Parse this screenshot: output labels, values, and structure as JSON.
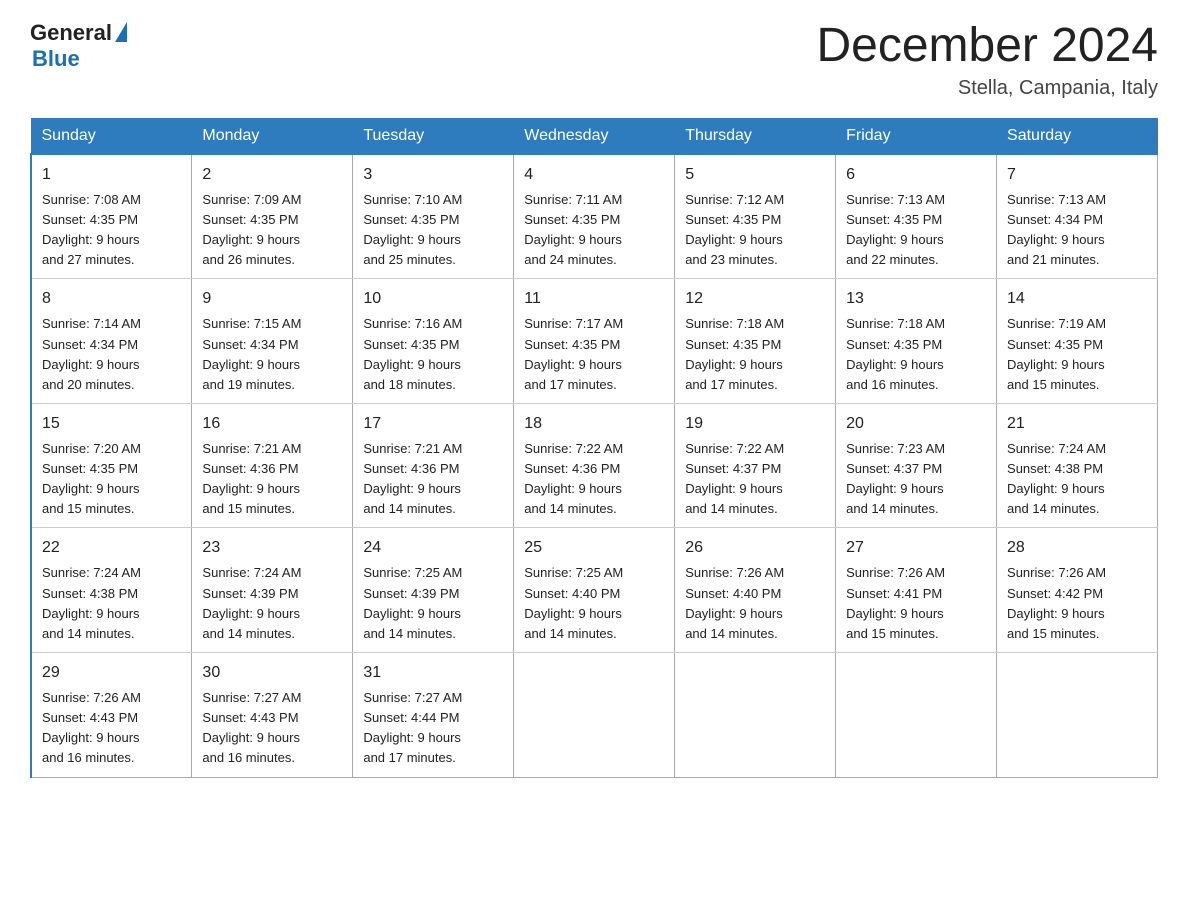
{
  "header": {
    "logo_general": "General",
    "logo_blue": "Blue",
    "month_title": "December 2024",
    "location": "Stella, Campania, Italy"
  },
  "days_of_week": [
    "Sunday",
    "Monday",
    "Tuesday",
    "Wednesday",
    "Thursday",
    "Friday",
    "Saturday"
  ],
  "weeks": [
    [
      {
        "day": "1",
        "sunrise": "7:08 AM",
        "sunset": "4:35 PM",
        "daylight": "9 hours and 27 minutes."
      },
      {
        "day": "2",
        "sunrise": "7:09 AM",
        "sunset": "4:35 PM",
        "daylight": "9 hours and 26 minutes."
      },
      {
        "day": "3",
        "sunrise": "7:10 AM",
        "sunset": "4:35 PM",
        "daylight": "9 hours and 25 minutes."
      },
      {
        "day": "4",
        "sunrise": "7:11 AM",
        "sunset": "4:35 PM",
        "daylight": "9 hours and 24 minutes."
      },
      {
        "day": "5",
        "sunrise": "7:12 AM",
        "sunset": "4:35 PM",
        "daylight": "9 hours and 23 minutes."
      },
      {
        "day": "6",
        "sunrise": "7:13 AM",
        "sunset": "4:35 PM",
        "daylight": "9 hours and 22 minutes."
      },
      {
        "day": "7",
        "sunrise": "7:13 AM",
        "sunset": "4:34 PM",
        "daylight": "9 hours and 21 minutes."
      }
    ],
    [
      {
        "day": "8",
        "sunrise": "7:14 AM",
        "sunset": "4:34 PM",
        "daylight": "9 hours and 20 minutes."
      },
      {
        "day": "9",
        "sunrise": "7:15 AM",
        "sunset": "4:34 PM",
        "daylight": "9 hours and 19 minutes."
      },
      {
        "day": "10",
        "sunrise": "7:16 AM",
        "sunset": "4:35 PM",
        "daylight": "9 hours and 18 minutes."
      },
      {
        "day": "11",
        "sunrise": "7:17 AM",
        "sunset": "4:35 PM",
        "daylight": "9 hours and 17 minutes."
      },
      {
        "day": "12",
        "sunrise": "7:18 AM",
        "sunset": "4:35 PM",
        "daylight": "9 hours and 17 minutes."
      },
      {
        "day": "13",
        "sunrise": "7:18 AM",
        "sunset": "4:35 PM",
        "daylight": "9 hours and 16 minutes."
      },
      {
        "day": "14",
        "sunrise": "7:19 AM",
        "sunset": "4:35 PM",
        "daylight": "9 hours and 15 minutes."
      }
    ],
    [
      {
        "day": "15",
        "sunrise": "7:20 AM",
        "sunset": "4:35 PM",
        "daylight": "9 hours and 15 minutes."
      },
      {
        "day": "16",
        "sunrise": "7:21 AM",
        "sunset": "4:36 PM",
        "daylight": "9 hours and 15 minutes."
      },
      {
        "day": "17",
        "sunrise": "7:21 AM",
        "sunset": "4:36 PM",
        "daylight": "9 hours and 14 minutes."
      },
      {
        "day": "18",
        "sunrise": "7:22 AM",
        "sunset": "4:36 PM",
        "daylight": "9 hours and 14 minutes."
      },
      {
        "day": "19",
        "sunrise": "7:22 AM",
        "sunset": "4:37 PM",
        "daylight": "9 hours and 14 minutes."
      },
      {
        "day": "20",
        "sunrise": "7:23 AM",
        "sunset": "4:37 PM",
        "daylight": "9 hours and 14 minutes."
      },
      {
        "day": "21",
        "sunrise": "7:24 AM",
        "sunset": "4:38 PM",
        "daylight": "9 hours and 14 minutes."
      }
    ],
    [
      {
        "day": "22",
        "sunrise": "7:24 AM",
        "sunset": "4:38 PM",
        "daylight": "9 hours and 14 minutes."
      },
      {
        "day": "23",
        "sunrise": "7:24 AM",
        "sunset": "4:39 PM",
        "daylight": "9 hours and 14 minutes."
      },
      {
        "day": "24",
        "sunrise": "7:25 AM",
        "sunset": "4:39 PM",
        "daylight": "9 hours and 14 minutes."
      },
      {
        "day": "25",
        "sunrise": "7:25 AM",
        "sunset": "4:40 PM",
        "daylight": "9 hours and 14 minutes."
      },
      {
        "day": "26",
        "sunrise": "7:26 AM",
        "sunset": "4:40 PM",
        "daylight": "9 hours and 14 minutes."
      },
      {
        "day": "27",
        "sunrise": "7:26 AM",
        "sunset": "4:41 PM",
        "daylight": "9 hours and 15 minutes."
      },
      {
        "day": "28",
        "sunrise": "7:26 AM",
        "sunset": "4:42 PM",
        "daylight": "9 hours and 15 minutes."
      }
    ],
    [
      {
        "day": "29",
        "sunrise": "7:26 AM",
        "sunset": "4:43 PM",
        "daylight": "9 hours and 16 minutes."
      },
      {
        "day": "30",
        "sunrise": "7:27 AM",
        "sunset": "4:43 PM",
        "daylight": "9 hours and 16 minutes."
      },
      {
        "day": "31",
        "sunrise": "7:27 AM",
        "sunset": "4:44 PM",
        "daylight": "9 hours and 17 minutes."
      },
      null,
      null,
      null,
      null
    ]
  ]
}
